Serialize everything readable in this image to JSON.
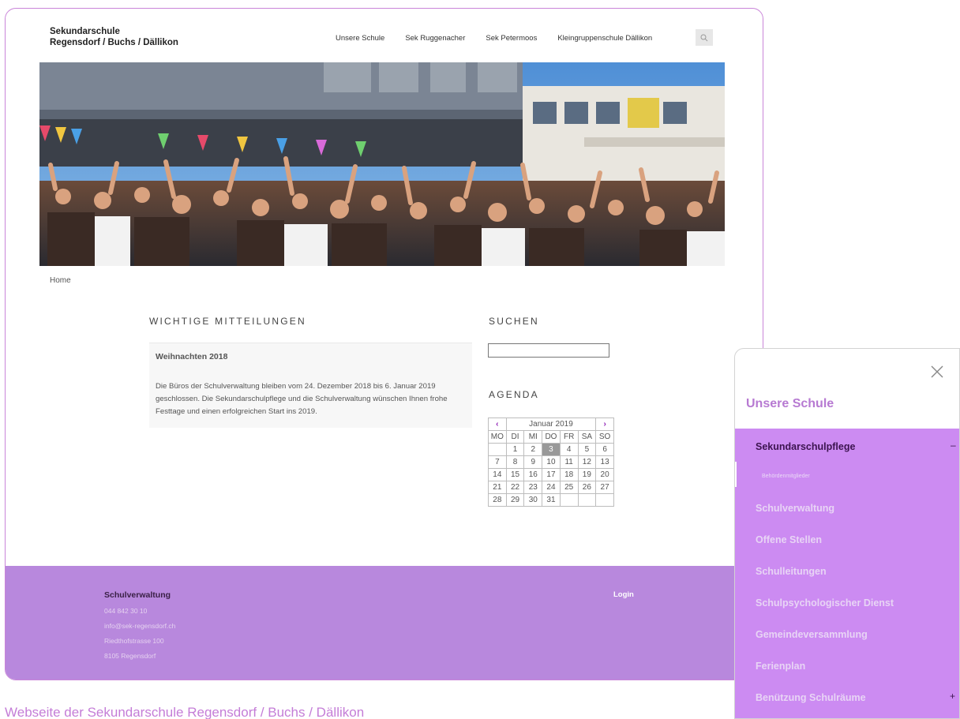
{
  "site": {
    "name_line1": "Sekundarschule",
    "name_line2": "Regensdorf / Buchs / Dällikon"
  },
  "nav": {
    "items": [
      "Unsere Schule",
      "Sek Ruggenacher",
      "Sek Petermoos",
      "Kleingruppenschule Dällikon"
    ],
    "search_icon": "magnifier-icon"
  },
  "breadcrumb": "Home",
  "notices": {
    "heading": "WICHTIGE MITTEILUNGEN",
    "title": "Weihnachten 2018",
    "body": "Die Büros der Schulverwaltung bleiben vom 24. Dezember 2018 bis 6. Januar 2019 geschlossen. Die Sekundarschulpflege und die Schulverwaltung wünschen Ihnen frohe Festtage und einen erfolgreichen Start ins 2019."
  },
  "search": {
    "heading": "SUCHEN",
    "value": ""
  },
  "agenda": {
    "heading": "AGENDA",
    "month": "Januar 2019",
    "prev": "‹",
    "next": "›",
    "weekdays": [
      "MO",
      "DI",
      "MI",
      "DO",
      "FR",
      "SA",
      "SO"
    ],
    "weeks": [
      [
        "",
        "1",
        "2",
        "3",
        "4",
        "5",
        "6"
      ],
      [
        "7",
        "8",
        "9",
        "10",
        "11",
        "12",
        "13"
      ],
      [
        "14",
        "15",
        "16",
        "17",
        "18",
        "19",
        "20"
      ],
      [
        "21",
        "22",
        "23",
        "24",
        "25",
        "26",
        "27"
      ],
      [
        "28",
        "29",
        "30",
        "31",
        "",
        "",
        ""
      ]
    ],
    "highlighted_day": "3"
  },
  "footer": {
    "title": "Schulverwaltung",
    "phone": "044 842 30 10",
    "email": "info@sek-regensdorf.ch",
    "street": "Riedthofstrasse 100",
    "city": "8105 Regensdorf",
    "login": "Login"
  },
  "caption": "Webseite der Sekundarschule Regensdorf / Buchs / Dällikon",
  "panel": {
    "close_icon": "close-icon",
    "title": "Unsere Schule",
    "active_item": "Sekundarschulpflege",
    "active_toggle": "–",
    "sub_item": "Behördenmitglieder",
    "items": [
      "Schulverwaltung",
      "Offene Stellen",
      "Schulleitungen",
      "Schulpsychologischer Dienst",
      "Gemeindeversammlung",
      "Ferienplan",
      "Benützung Schulräume"
    ],
    "last_toggle": "+"
  },
  "colors": {
    "accent": "#b888dd",
    "menu_bg": "#cc8bf2",
    "frame_border": "#c985d9",
    "caption": "#c47dd7",
    "nav_arrow": "#8e1eb4"
  }
}
